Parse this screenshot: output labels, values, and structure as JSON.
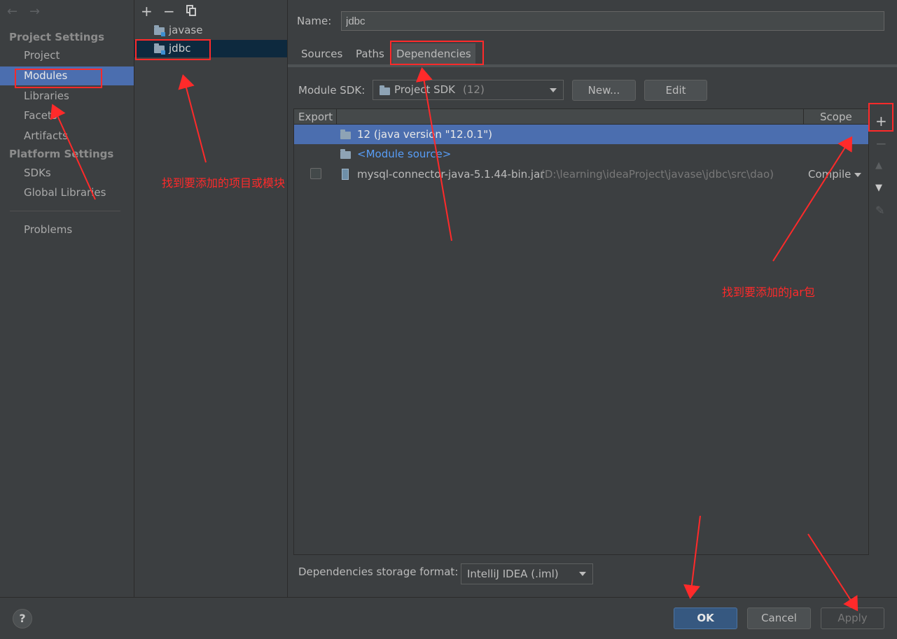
{
  "nav": {
    "back_icon": "arrow-left-icon",
    "forward_icon": "arrow-right-icon",
    "project_settings_header": "Project Settings",
    "project": "Project",
    "modules": "Modules",
    "libraries": "Libraries",
    "facets": "Facets",
    "artifacts": "Artifacts",
    "platform_settings_header": "Platform Settings",
    "sdks": "SDKs",
    "global_libraries": "Global Libraries",
    "problems": "Problems"
  },
  "tree": {
    "add": "+",
    "remove": "−",
    "copy_icon": "copy-icon",
    "modules": [
      "javase",
      "jdbc"
    ],
    "selected": "jdbc"
  },
  "module": {
    "name_label": "Name:",
    "name_value": "jdbc",
    "tabs": [
      "Sources",
      "Paths",
      "Dependencies"
    ],
    "active_tab": "Dependencies",
    "sdk_label": "Module SDK:",
    "sdk_value": "Project SDK",
    "sdk_version": "(12)",
    "new_button": "New...",
    "edit_button": "Edit"
  },
  "dependencies": {
    "columns": {
      "export": "Export",
      "scope": "Scope"
    },
    "rows": [
      {
        "label": "12 (java version \"12.0.1\")",
        "selected": true
      },
      {
        "label": "<Module source>"
      },
      {
        "label": "mysql-connector-java-5.1.44-bin.jar",
        "path": "(D:\\learning\\ideaProject\\javase\\jdbc\\src\\dao)",
        "scope": "Compile"
      }
    ],
    "side_buttons": [
      "+",
      "−",
      "▲",
      "▼",
      "✎"
    ],
    "storage_label": "Dependencies storage format:",
    "storage_value": "IntelliJ IDEA (.iml)"
  },
  "footer": {
    "help": "?",
    "ok": "OK",
    "cancel": "Cancel",
    "apply": "Apply"
  },
  "annotations": {
    "note_module": "找到要添加的项目或模块",
    "note_jar": "找到要添加的jar包"
  },
  "colors": {
    "selection": "#4b6eaf",
    "annotation": "#ff2a2a",
    "link": "#589df6"
  }
}
